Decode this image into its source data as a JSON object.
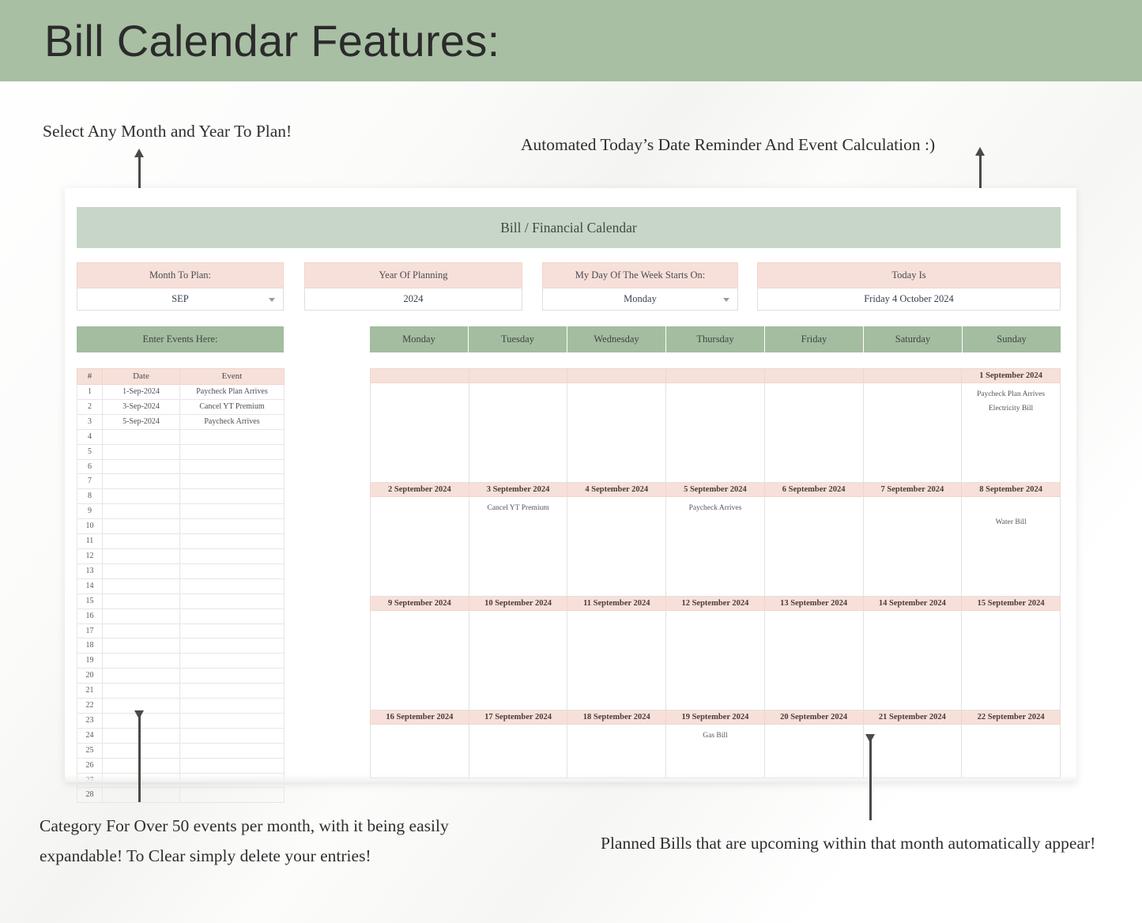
{
  "banner": {
    "title": "Bill Calendar Features:"
  },
  "annotations": {
    "top_left": "Select Any Month and Year To Plan!",
    "top_right": "Automated Today’s Date Reminder And Event Calculation :)",
    "bottom_left": "Category For Over 50 events per month, with it being easily expandable! To Clear simply delete your entries!",
    "bottom_right": "Planned Bills that are upcoming within that month automatically appear!"
  },
  "sheet": {
    "title": "Bill / Financial Calendar",
    "controls": [
      {
        "label": "Month To Plan:",
        "value": "SEP",
        "dropdown": true
      },
      {
        "label": "Year Of Planning",
        "value": "2024",
        "dropdown": false
      },
      {
        "label": "My Day Of The Week Starts On:",
        "value": "Monday",
        "dropdown": true
      },
      {
        "label": "Today Is",
        "value": "Friday 4 October 2024",
        "dropdown": false
      }
    ],
    "events_panel": {
      "header": "Enter Events Here:",
      "columns": [
        "#",
        "Date",
        "Event"
      ],
      "rows": [
        {
          "n": "1",
          "date": "1-Sep-2024",
          "event": "Paycheck Plan Arrives"
        },
        {
          "n": "2",
          "date": "3-Sep-2024",
          "event": "Cancel YT Premium"
        },
        {
          "n": "3",
          "date": "5-Sep-2024",
          "event": "Paycheck Arrives"
        },
        {
          "n": "4",
          "date": "",
          "event": ""
        },
        {
          "n": "5",
          "date": "",
          "event": ""
        },
        {
          "n": "6",
          "date": "",
          "event": ""
        },
        {
          "n": "7",
          "date": "",
          "event": ""
        },
        {
          "n": "8",
          "date": "",
          "event": ""
        },
        {
          "n": "9",
          "date": "",
          "event": ""
        },
        {
          "n": "10",
          "date": "",
          "event": ""
        },
        {
          "n": "11",
          "date": "",
          "event": ""
        },
        {
          "n": "12",
          "date": "",
          "event": ""
        },
        {
          "n": "13",
          "date": "",
          "event": ""
        },
        {
          "n": "14",
          "date": "",
          "event": ""
        },
        {
          "n": "15",
          "date": "",
          "event": ""
        },
        {
          "n": "16",
          "date": "",
          "event": ""
        },
        {
          "n": "17",
          "date": "",
          "event": ""
        },
        {
          "n": "18",
          "date": "",
          "event": ""
        },
        {
          "n": "19",
          "date": "",
          "event": ""
        },
        {
          "n": "20",
          "date": "",
          "event": ""
        },
        {
          "n": "21",
          "date": "",
          "event": ""
        },
        {
          "n": "22",
          "date": "",
          "event": ""
        },
        {
          "n": "23",
          "date": "",
          "event": ""
        },
        {
          "n": "24",
          "date": "",
          "event": ""
        },
        {
          "n": "25",
          "date": "",
          "event": ""
        },
        {
          "n": "26",
          "date": "",
          "event": ""
        },
        {
          "n": "27",
          "date": "",
          "event": ""
        },
        {
          "n": "28",
          "date": "",
          "event": ""
        }
      ]
    },
    "calendar": {
      "weekdays": [
        "Monday",
        "Tuesday",
        "Wednesday",
        "Thursday",
        "Friday",
        "Saturday",
        "Sunday"
      ],
      "weeks": [
        {
          "days": [
            {
              "date": "",
              "events": []
            },
            {
              "date": "",
              "events": []
            },
            {
              "date": "",
              "events": []
            },
            {
              "date": "",
              "events": []
            },
            {
              "date": "",
              "events": []
            },
            {
              "date": "",
              "events": []
            },
            {
              "date": "1 September 2024",
              "events": [
                "Paycheck Plan Arrives",
                "Electricity Bill"
              ]
            }
          ]
        },
        {
          "days": [
            {
              "date": "2 September 2024",
              "events": []
            },
            {
              "date": "3 September 2024",
              "events": [
                "Cancel YT Premium"
              ]
            },
            {
              "date": "4 September 2024",
              "events": []
            },
            {
              "date": "5 September 2024",
              "events": [
                "Paycheck Arrives"
              ]
            },
            {
              "date": "6 September 2024",
              "events": []
            },
            {
              "date": "7 September 2024",
              "events": []
            },
            {
              "date": "8 September 2024",
              "events": [
                "",
                "Water Bill"
              ]
            }
          ]
        },
        {
          "days": [
            {
              "date": "9 September 2024",
              "events": []
            },
            {
              "date": "10 September 2024",
              "events": []
            },
            {
              "date": "11 September 2024",
              "events": []
            },
            {
              "date": "12 September 2024",
              "events": []
            },
            {
              "date": "13 September 2024",
              "events": []
            },
            {
              "date": "14 September 2024",
              "events": []
            },
            {
              "date": "15 September 2024",
              "events": []
            }
          ]
        },
        {
          "days": [
            {
              "date": "16 September 2024",
              "events": []
            },
            {
              "date": "17 September 2024",
              "events": []
            },
            {
              "date": "18 September 2024",
              "events": []
            },
            {
              "date": "19 September 2024",
              "events": [
                "Gas Bill"
              ]
            },
            {
              "date": "20 September 2024",
              "events": []
            },
            {
              "date": "21 September 2024",
              "events": []
            },
            {
              "date": "22 September 2024",
              "events": []
            }
          ]
        }
      ]
    }
  },
  "colors": {
    "banner_green": "#a8bfa4",
    "title_green": "#c7d6c6",
    "header_green": "#a4bda0",
    "pink": "#f7e0d9",
    "text_dark": "#2b2b2b"
  }
}
